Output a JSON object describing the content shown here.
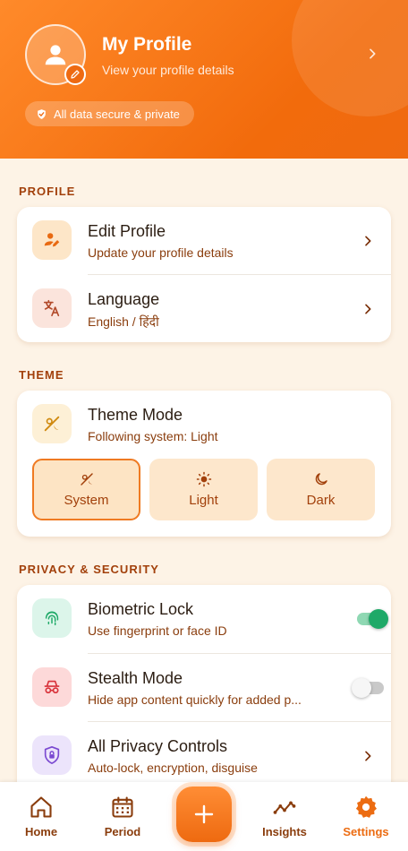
{
  "header": {
    "title": "My Profile",
    "subtitle": "View your profile details",
    "secure_badge": "All data secure & private"
  },
  "sections": {
    "profile": "PROFILE",
    "theme": "THEME",
    "privacy": "PRIVACY & SECURITY"
  },
  "profile": {
    "edit_title": "Edit Profile",
    "edit_sub": "Update your profile details",
    "language_title": "Language",
    "language_sub": "English / हिंदी"
  },
  "theme": {
    "title": "Theme Mode",
    "sub": "Following system: Light",
    "options": [
      "System",
      "Light",
      "Dark"
    ],
    "selected": "System"
  },
  "privacy": {
    "biometric_title": "Biometric Lock",
    "biometric_sub": "Use fingerprint or face ID",
    "biometric_on": true,
    "stealth_title": "Stealth Mode",
    "stealth_sub": "Hide app content quickly for added p...",
    "stealth_on": false,
    "controls_title": "All Privacy Controls",
    "controls_sub": "Auto-lock, encryption, disguise"
  },
  "nav": {
    "home": "Home",
    "period": "Period",
    "insights": "Insights",
    "settings": "Settings",
    "active": "Settings"
  },
  "colors": {
    "accent": "#ef6a10",
    "toggle_on": "#1fa968",
    "section_label": "#a2400b"
  }
}
